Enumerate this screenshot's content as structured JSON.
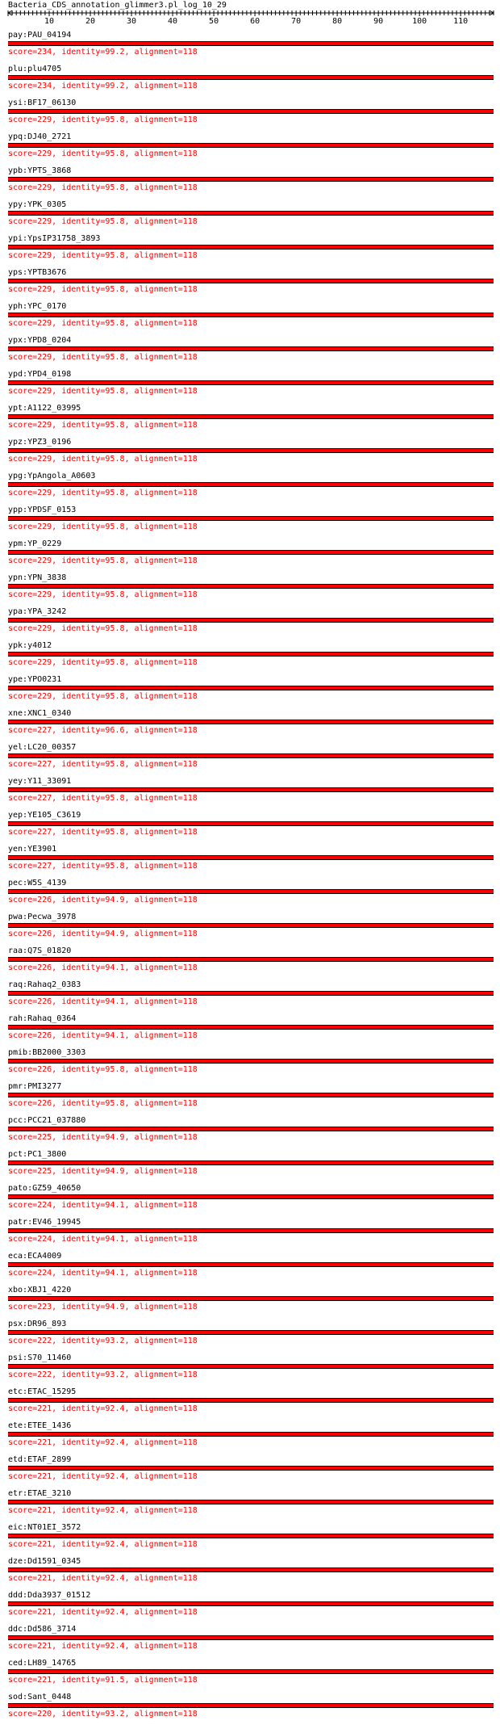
{
  "title": "Bacteria_CDS_annotation_glimmer3.pl_log_10_29",
  "ruler": {
    "max": 118,
    "ticks": [
      10,
      20,
      30,
      40,
      50,
      60,
      70,
      80,
      90,
      100,
      110
    ]
  },
  "colors": {
    "bar": "#ff0000",
    "score_text": "#ff0000",
    "outline": "#000000"
  },
  "hits": [
    {
      "name": "pay:PAU_04194",
      "score": "score=234, identity=99.2, alignment=118"
    },
    {
      "name": "plu:plu4705",
      "score": "score=234, identity=99.2, alignment=118"
    },
    {
      "name": "ysi:BF17_06130",
      "score": "score=229, identity=95.8, alignment=118"
    },
    {
      "name": "ypq:DJ40_2721",
      "score": "score=229, identity=95.8, alignment=118"
    },
    {
      "name": "ypb:YPTS_3868",
      "score": "score=229, identity=95.8, alignment=118"
    },
    {
      "name": "ypy:YPK_0305",
      "score": "score=229, identity=95.8, alignment=118"
    },
    {
      "name": "ypi:YpsIP31758_3893",
      "score": "score=229, identity=95.8, alignment=118"
    },
    {
      "name": "yps:YPTB3676",
      "score": "score=229, identity=95.8, alignment=118"
    },
    {
      "name": "yph:YPC_0170",
      "score": "score=229, identity=95.8, alignment=118"
    },
    {
      "name": "ypx:YPD8_0204",
      "score": "score=229, identity=95.8, alignment=118"
    },
    {
      "name": "ypd:YPD4_0198",
      "score": "score=229, identity=95.8, alignment=118"
    },
    {
      "name": "ypt:A1122_03995",
      "score": "score=229, identity=95.8, alignment=118"
    },
    {
      "name": "ypz:YPZ3_0196",
      "score": "score=229, identity=95.8, alignment=118"
    },
    {
      "name": "ypg:YpAngola_A0603",
      "score": "score=229, identity=95.8, alignment=118"
    },
    {
      "name": "ypp:YPDSF_0153",
      "score": "score=229, identity=95.8, alignment=118"
    },
    {
      "name": "ypm:YP_0229",
      "score": "score=229, identity=95.8, alignment=118"
    },
    {
      "name": "ypn:YPN_3838",
      "score": "score=229, identity=95.8, alignment=118"
    },
    {
      "name": "ypa:YPA_3242",
      "score": "score=229, identity=95.8, alignment=118"
    },
    {
      "name": "ypk:y4012",
      "score": "score=229, identity=95.8, alignment=118"
    },
    {
      "name": "ype:YPO0231",
      "score": "score=229, identity=95.8, alignment=118"
    },
    {
      "name": "xne:XNC1_0340",
      "score": "score=227, identity=96.6, alignment=118"
    },
    {
      "name": "yel:LC20_00357",
      "score": "score=227, identity=95.8, alignment=118"
    },
    {
      "name": "yey:Y11_33091",
      "score": "score=227, identity=95.8, alignment=118"
    },
    {
      "name": "yep:YE105_C3619",
      "score": "score=227, identity=95.8, alignment=118"
    },
    {
      "name": "yen:YE3901",
      "score": "score=227, identity=95.8, alignment=118"
    },
    {
      "name": "pec:W5S_4139",
      "score": "score=226, identity=94.9, alignment=118"
    },
    {
      "name": "pwa:Pecwa_3978",
      "score": "score=226, identity=94.9, alignment=118"
    },
    {
      "name": "raa:Q7S_01820",
      "score": "score=226, identity=94.1, alignment=118"
    },
    {
      "name": "raq:Rahaq2_0383",
      "score": "score=226, identity=94.1, alignment=118"
    },
    {
      "name": "rah:Rahaq_0364",
      "score": "score=226, identity=94.1, alignment=118"
    },
    {
      "name": "pmib:BB2000_3303",
      "score": "score=226, identity=95.8, alignment=118"
    },
    {
      "name": "pmr:PMI3277",
      "score": "score=226, identity=95.8, alignment=118"
    },
    {
      "name": "pcc:PCC21_037880",
      "score": "score=225, identity=94.9, alignment=118"
    },
    {
      "name": "pct:PC1_3800",
      "score": "score=225, identity=94.9, alignment=118"
    },
    {
      "name": "pato:GZ59_40650",
      "score": "score=224, identity=94.1, alignment=118"
    },
    {
      "name": "patr:EV46_19945",
      "score": "score=224, identity=94.1, alignment=118"
    },
    {
      "name": "eca:ECA4009",
      "score": "score=224, identity=94.1, alignment=118"
    },
    {
      "name": "xbo:XBJ1_4220",
      "score": "score=223, identity=94.9, alignment=118"
    },
    {
      "name": "psx:DR96_893",
      "score": "score=222, identity=93.2, alignment=118"
    },
    {
      "name": "psi:S70_11460",
      "score": "score=222, identity=93.2, alignment=118"
    },
    {
      "name": "etc:ETAC_15295",
      "score": "score=221, identity=92.4, alignment=118"
    },
    {
      "name": "ete:ETEE_1436",
      "score": "score=221, identity=92.4, alignment=118"
    },
    {
      "name": "etd:ETAF_2899",
      "score": "score=221, identity=92.4, alignment=118"
    },
    {
      "name": "etr:ETAE_3210",
      "score": "score=221, identity=92.4, alignment=118"
    },
    {
      "name": "eic:NT01EI_3572",
      "score": "score=221, identity=92.4, alignment=118"
    },
    {
      "name": "dze:Dd1591_0345",
      "score": "score=221, identity=92.4, alignment=118"
    },
    {
      "name": "ddd:Dda3937_01512",
      "score": "score=221, identity=92.4, alignment=118"
    },
    {
      "name": "ddc:Dd586_3714",
      "score": "score=221, identity=92.4, alignment=118"
    },
    {
      "name": "ced:LH89_14765",
      "score": "score=221, identity=91.5, alignment=118"
    },
    {
      "name": "sod:Sant_0448",
      "score": "score=220, identity=93.2, alignment=118"
    }
  ]
}
